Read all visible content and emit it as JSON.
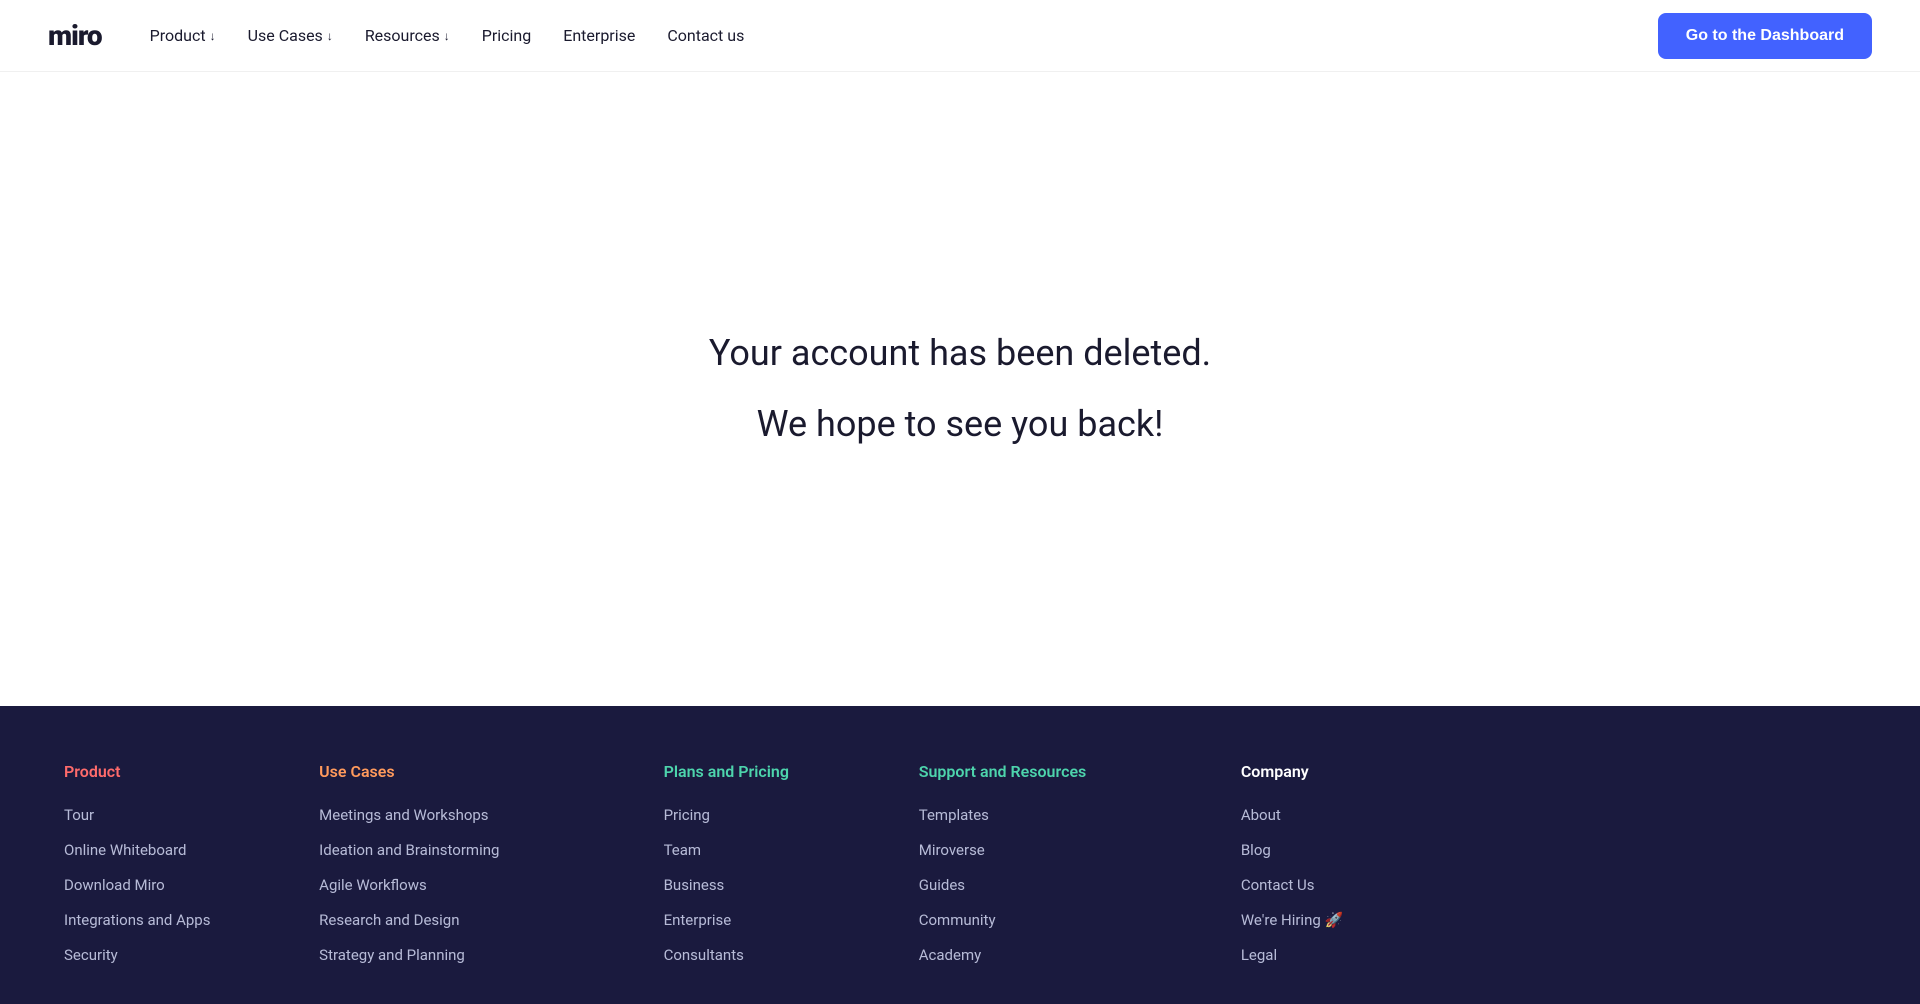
{
  "header": {
    "logo": "miro",
    "nav": [
      {
        "label": "Product",
        "hasArrow": true,
        "id": "product"
      },
      {
        "label": "Use Cases",
        "hasArrow": true,
        "id": "use-cases"
      },
      {
        "label": "Resources",
        "hasArrow": true,
        "id": "resources"
      },
      {
        "label": "Pricing",
        "hasArrow": false,
        "id": "pricing"
      },
      {
        "label": "Enterprise",
        "hasArrow": false,
        "id": "enterprise"
      },
      {
        "label": "Contact us",
        "hasArrow": false,
        "id": "contact"
      }
    ],
    "cta_label": "Go to the Dashboard"
  },
  "main": {
    "line1": "Your account has been deleted.",
    "line2": "We hope to see you back!"
  },
  "footer": {
    "columns": [
      {
        "title": "Product",
        "title_class": "product",
        "links": [
          "Tour",
          "Online Whiteboard",
          "Download Miro",
          "Integrations and Apps",
          "Security"
        ]
      },
      {
        "title": "Use Cases",
        "title_class": "use-cases",
        "links": [
          "Meetings and Workshops",
          "Ideation and Brainstorming",
          "Agile Workflows",
          "Research and Design",
          "Strategy and Planning"
        ]
      },
      {
        "title": "Plans and Pricing",
        "title_class": "plans",
        "links": [
          "Pricing",
          "Team",
          "Business",
          "Enterprise",
          "Consultants"
        ]
      },
      {
        "title": "Support and Resources",
        "title_class": "support",
        "links": [
          "Templates",
          "Miroverse",
          "Guides",
          "Community",
          "Academy"
        ]
      },
      {
        "title": "Company",
        "title_class": "company",
        "links": [
          "About",
          "Blog",
          "Contact Us",
          "We're Hiring 🚀",
          "Legal"
        ]
      }
    ]
  }
}
